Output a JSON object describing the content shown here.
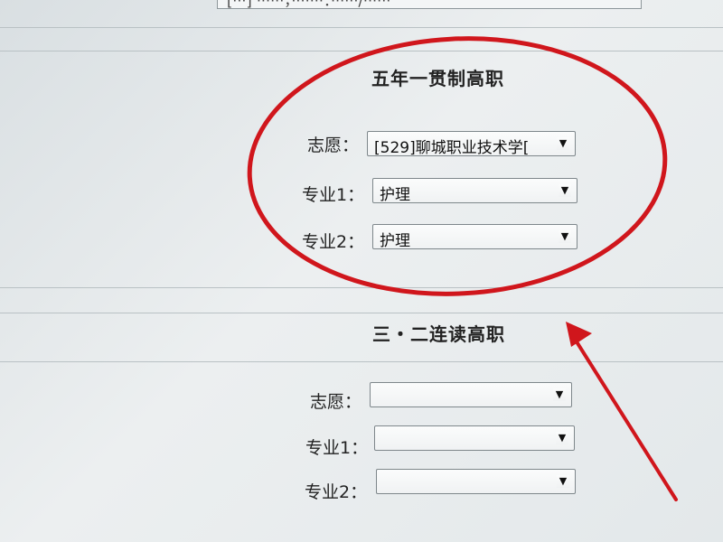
{
  "top_dropdown": {
    "value": "[···] ······，·······：······/······"
  },
  "five_year_section": {
    "title": "五年一贯制高职",
    "wish_label": "志愿：",
    "wish_value": "[529]聊城职业技术学[",
    "major1_label": "专业1：",
    "major1_value": "护理",
    "major2_label": "专业2：",
    "major2_value": "护理"
  },
  "three_two_section": {
    "title": "三・二连读高职",
    "wish_label": "志愿：",
    "wish_value": "",
    "major1_label": "专业1：",
    "major1_value": "",
    "major2_label": "专业2：",
    "major2_value": ""
  },
  "icons": {
    "dropdown": "chevron-down-icon",
    "annotation_circle": "red-circle-annotation",
    "annotation_arrow": "red-arrow-annotation"
  },
  "colors": {
    "annotation": "#d0161c"
  }
}
